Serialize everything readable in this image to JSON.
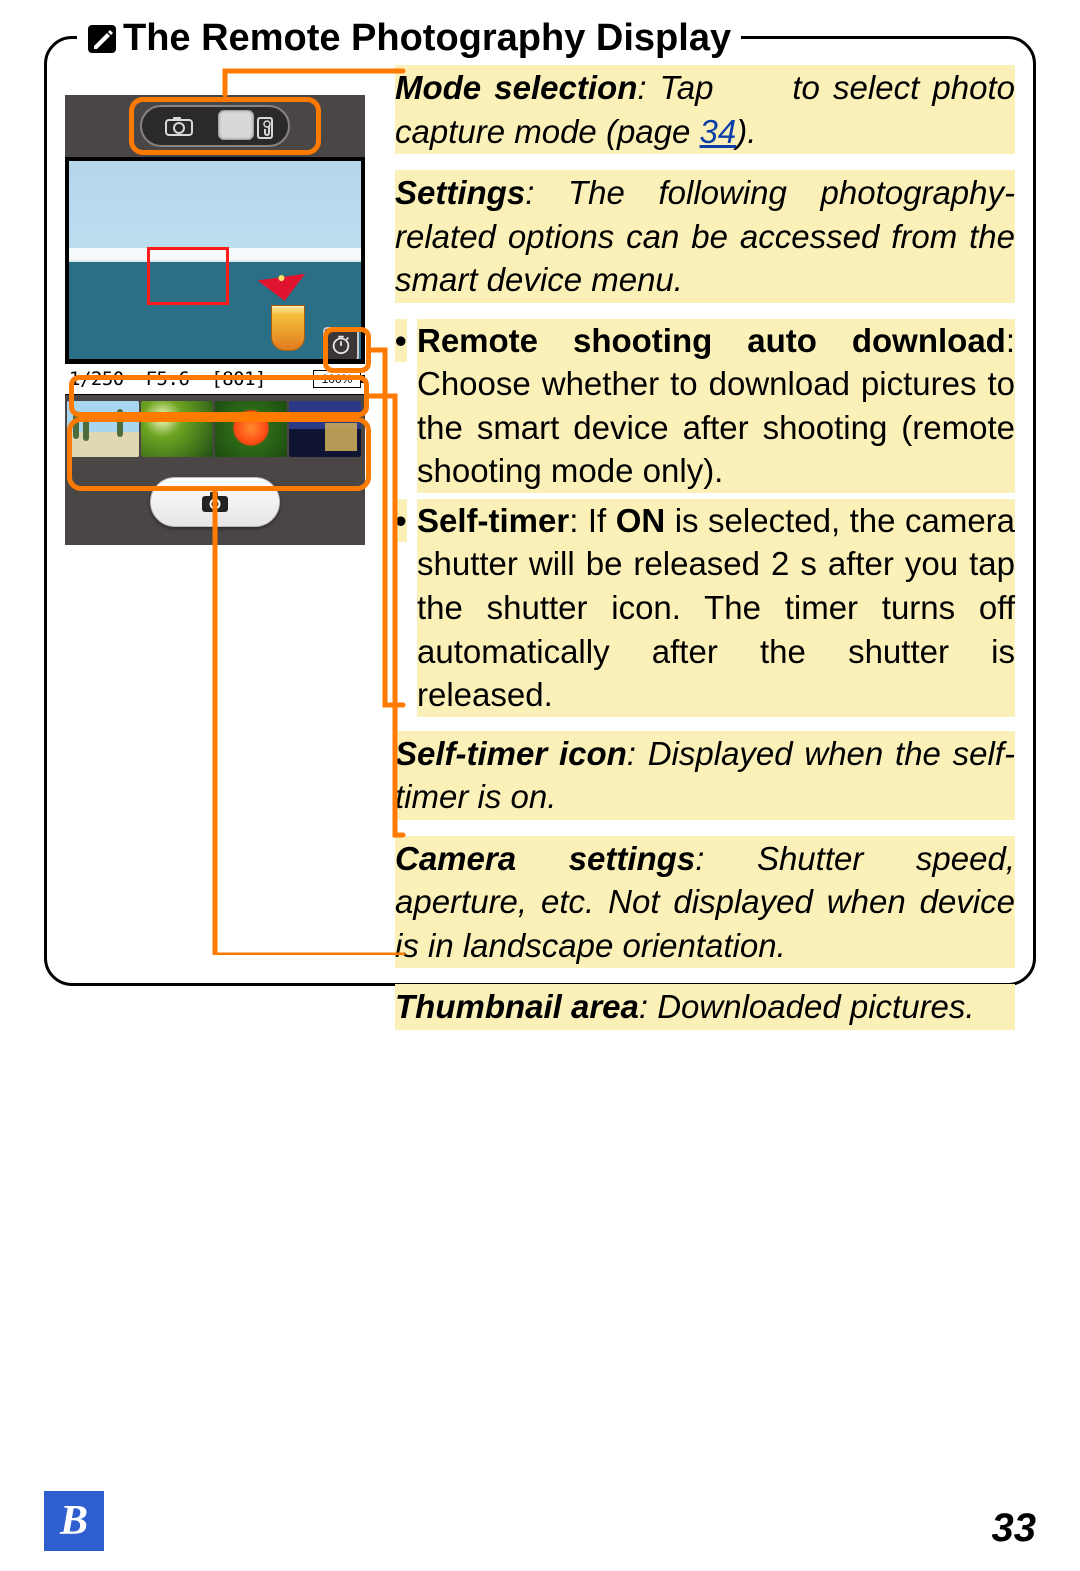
{
  "title": "The Remote Photography Display",
  "phone": {
    "info_bar": {
      "shutter": "1/250",
      "aperture": "F5.6",
      "remaining": "[801]",
      "battery": "100%"
    }
  },
  "desc": {
    "mode_label": "Mode selection",
    "mode_text_a": ": Tap ",
    "mode_text_b": " to select photo capture mode (page ",
    "mode_page": "34",
    "mode_text_c": ").",
    "settings_label": "Settings",
    "settings_text": ": The following photography-related options can be accessed from the smart device menu.",
    "opt1_label": "Remote shooting auto download",
    "opt1_text": ": Choose whether to download pictures to the smart device after shooting (remote shooting mode only).",
    "opt2_label": "Self-timer",
    "opt2_text_a": ": If ",
    "opt2_on": "ON",
    "opt2_text_b": " is selected, the camera shutter will be released 2 s after you tap the shutter icon. The timer turns off automatically after the shutter is released.",
    "sticon_label": "Self-timer icon",
    "sticon_text": ": Displayed when the self-timer is on.",
    "camset_label": "Camera settings",
    "camset_text": ": Shutter speed, aperture, etc. Not displayed when device is in landscape orientation.",
    "thumb_label": "Thumbnail area",
    "thumb_text": ": Downloaded pictures."
  },
  "footer": {
    "tab": "B",
    "page": "33"
  }
}
